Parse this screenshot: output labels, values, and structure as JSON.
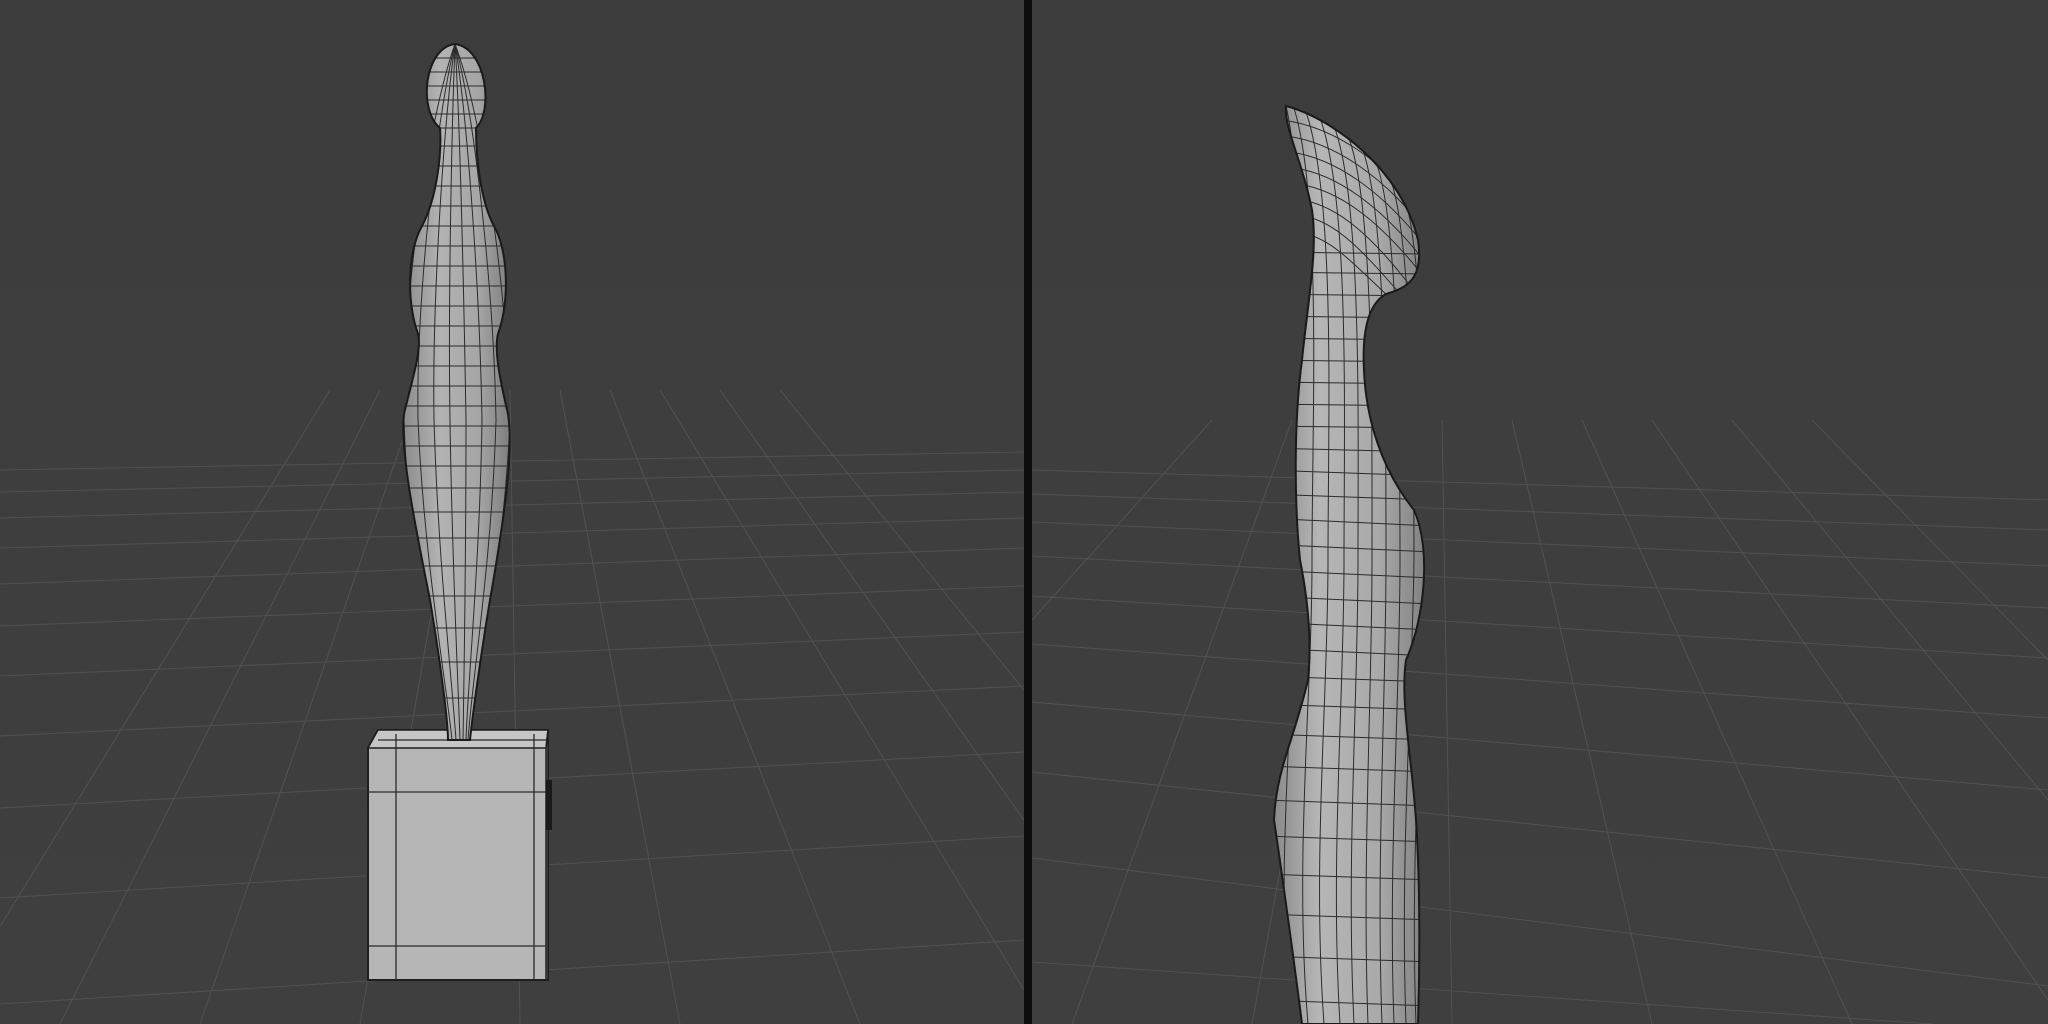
{
  "app": "3D viewport",
  "viewports": [
    {
      "id": "left",
      "view": "front",
      "objects": [
        "sculpture-body",
        "pedestal-block"
      ],
      "overlay": "wireframe-grid"
    },
    {
      "id": "right",
      "view": "side-closeup",
      "objects": [
        "sculpture-body"
      ],
      "overlay": "wireframe-grid"
    }
  ],
  "colors": {
    "background": "#3d3d3d",
    "grid": "#555555",
    "mesh_fill": "#a7a7a7",
    "wire": "#2b2b2b",
    "divider": "#0d0d0d"
  }
}
